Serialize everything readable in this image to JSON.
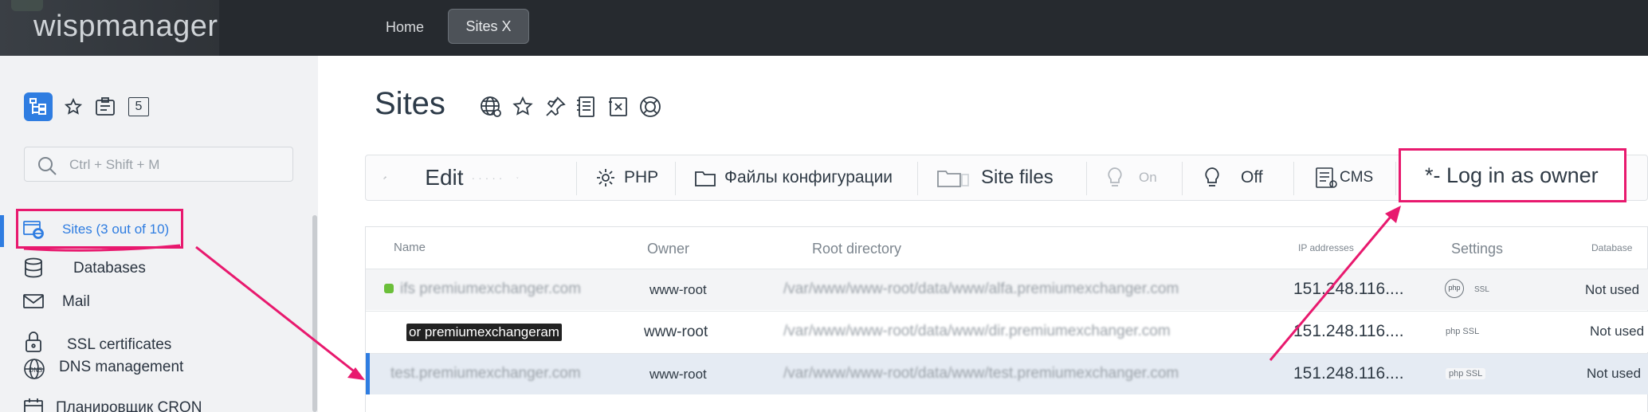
{
  "app": {
    "logo": "wispmanager"
  },
  "topnav": {
    "home": "Home",
    "active_tab": "Sites X"
  },
  "sidebar": {
    "icons": [
      "tree-icon",
      "star-icon",
      "clipboard-icon",
      "counter-icon"
    ],
    "counter": "5",
    "search_placeholder": "Ctrl + Shift + M",
    "items": [
      {
        "label": "Sites (3 out of 10)",
        "icon": "sites-icon",
        "active": true
      },
      {
        "label": "Databases",
        "icon": "database-icon"
      },
      {
        "label": "Mail",
        "icon": "mail-icon"
      },
      {
        "label": "SSL certificates",
        "icon": "lock-icon"
      },
      {
        "label": "DNS management",
        "icon": "dns-icon"
      },
      {
        "label": "Планировщик CRON",
        "icon": "calendar-icon"
      }
    ]
  },
  "main": {
    "title": "Sites",
    "title_icons": [
      "globe-icon",
      "star-icon",
      "pin-icon",
      "log-icon",
      "export-icon",
      "help-icon"
    ]
  },
  "toolbar": {
    "edit": "Edit",
    "php": "PHP",
    "config_files": "Файлы конфигурации",
    "site_files": "Site files",
    "on": "On",
    "off": "Off",
    "cms": "CMS",
    "log_in_as_owner": "*- Log in as owner"
  },
  "table": {
    "headers": {
      "name": "Name",
      "owner": "Owner",
      "root": "Root directory",
      "ip": "IP addresses",
      "settings": "Settings",
      "database": "Database"
    },
    "rows": [
      {
        "name": "ifs premiumexchanger.com",
        "owner": "www-root",
        "root": "/var/www/www-root/data/www/alfa.premiumexchanger.com",
        "ip": "151.248.116....",
        "settings": "php SSL",
        "database": "Not used"
      },
      {
        "name": "or premiumexchangeram",
        "owner": "www-root",
        "root": "/var/www/www-root/data/www/dir.premiumexchanger.com",
        "ip": "151.248.116....",
        "settings": "php SSL",
        "database": "Not used"
      },
      {
        "name": "test.premiumexchanger.com",
        "owner": "www-root",
        "root": "/var/www/www-root/data/www/test.premiumexchanger.com",
        "ip": "151.248.116....",
        "settings": "php SSL",
        "database": "Not used"
      }
    ]
  },
  "colors": {
    "accent": "#2f7de1",
    "annotation": "#e8196e",
    "topbar": "#262a2f"
  }
}
